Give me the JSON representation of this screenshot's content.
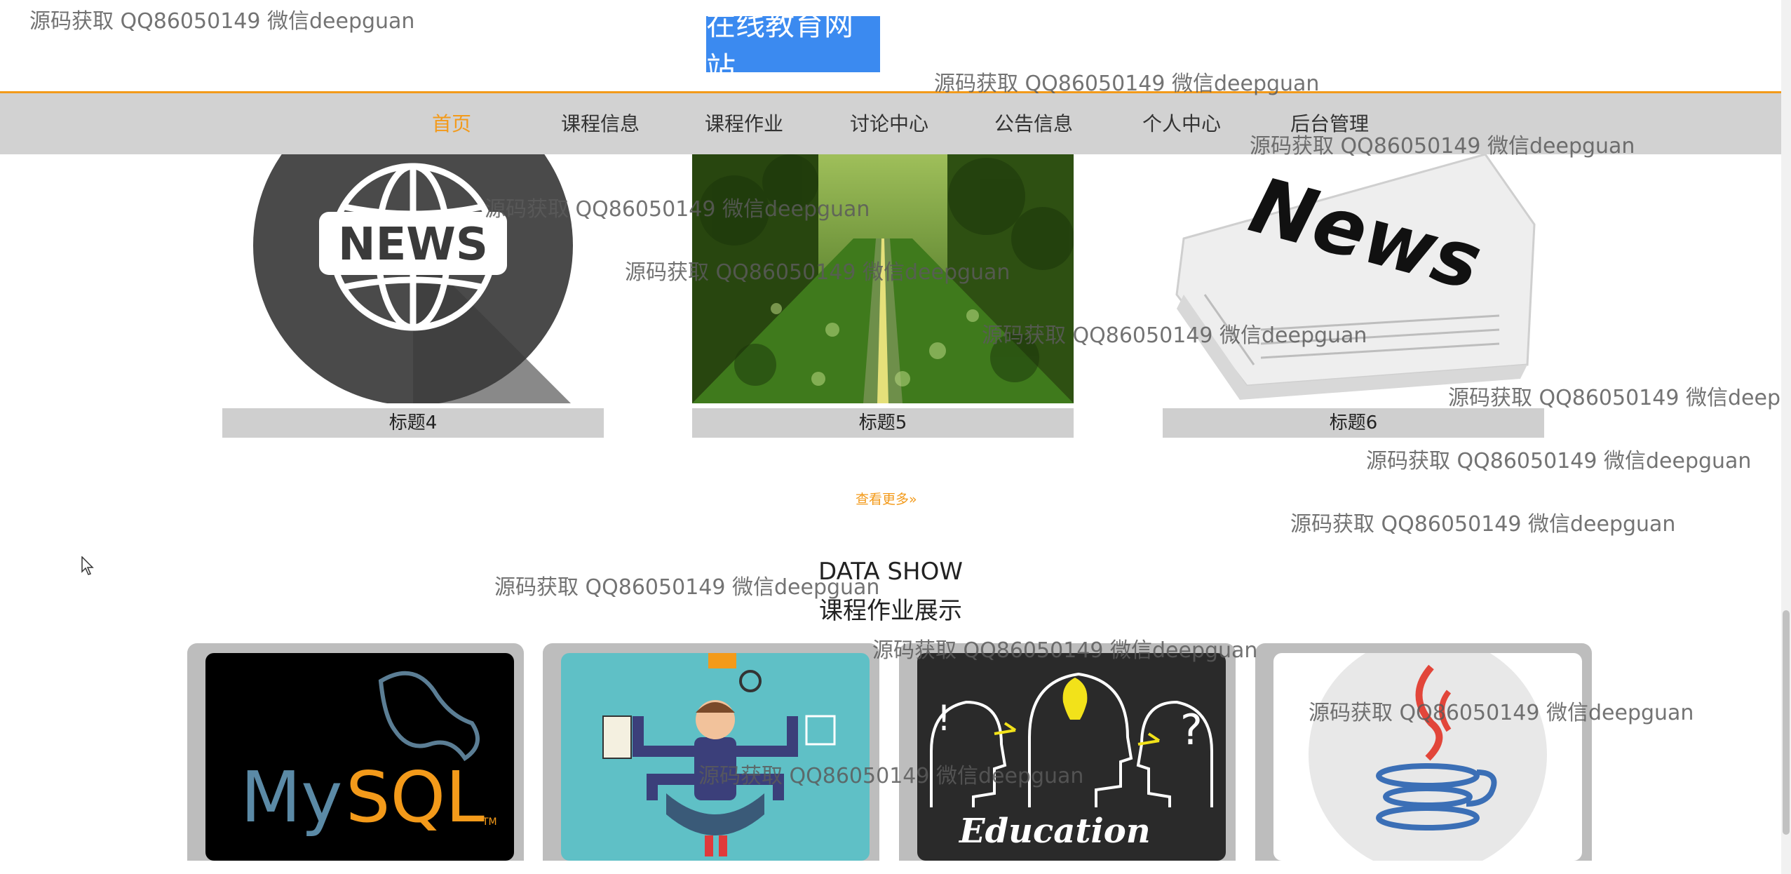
{
  "header": {
    "brand": "在线教育网站"
  },
  "nav": {
    "items": [
      {
        "label": "首页",
        "active": true
      },
      {
        "label": "课程信息"
      },
      {
        "label": "课程作业"
      },
      {
        "label": "讨论中心"
      },
      {
        "label": "公告信息"
      },
      {
        "label": "个人中心"
      },
      {
        "label": "后台管理"
      }
    ]
  },
  "news": {
    "cards": [
      {
        "title": "标题4",
        "image": "news-globe-icon"
      },
      {
        "title": "标题5",
        "image": "tree-lined-road-photo"
      },
      {
        "title": "标题6",
        "image": "newspaper-photo"
      }
    ],
    "more_label": "查看更多»"
  },
  "showcase": {
    "title_en": "DATA SHOW",
    "title_cn": "课程作业展示",
    "items": [
      {
        "image": "mysql-logo"
      },
      {
        "image": "multitasking-man-illustration"
      },
      {
        "image": "education-chalkboard"
      },
      {
        "image": "java-logo"
      }
    ]
  },
  "watermark": "源码获取 QQ86050149 微信deepguan",
  "colors": {
    "accent": "#f39a1a",
    "brand_bg": "#3b8af0",
    "nav_bg": "#d2d2d2",
    "caption_bg": "#cfcfcf"
  }
}
